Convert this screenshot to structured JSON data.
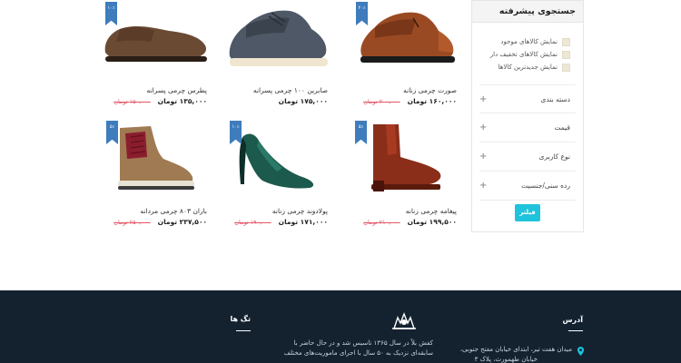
{
  "sidebar": {
    "title": "جستجوی پیشرفته",
    "checkboxes": [
      {
        "label": "نمایش کالاهای موجود"
      },
      {
        "label": "نمایش کالاهای تخفیف دار"
      },
      {
        "label": "نمایش جدیدترین کالاها"
      }
    ],
    "accordions": [
      {
        "label": "دسته بندی",
        "icon": "+"
      },
      {
        "label": "قیمت",
        "icon": "+"
      },
      {
        "label": "نوع کاربری",
        "icon": "+"
      },
      {
        "label": "رده سنی/جنسیت",
        "icon": "+"
      }
    ],
    "filter_button": "فیلتر"
  },
  "products": [
    {
      "name": "صورت چرمی زنانه",
      "price": "۱۶۰,۰۰۰ تومان",
      "old_price": "۲۰۰,۰۰۰ تومان",
      "ribbon": "۲۰٪"
    },
    {
      "name": "صابرین ۱۰۰ چرمی پسرانه",
      "price": "۱۷۵,۰۰۰ تومان",
      "old_price": "",
      "ribbon": ""
    },
    {
      "name": "پطرس چرمی پسرانه",
      "price": "۱۳۵,۰۰۰ تومان",
      "old_price": "۱۵۰,۰۰۰ تومان",
      "ribbon": "۱۰٪"
    },
    {
      "name": "پیغامه چرمی زنانه",
      "price": "۱۹۹,۵۰۰ تومان",
      "old_price": "۲۱۰,۰۰۰ تومان",
      "ribbon": "۵٪"
    },
    {
      "name": "پولادوند چرمی زنانه",
      "price": "۱۷۱,۰۰۰ تومان",
      "old_price": "۱۹۰,۰۰۰ تومان",
      "ribbon": "۱۰٪"
    },
    {
      "name": "باران ۸۰۳ چرمی مردانه",
      "price": "۲۳۷,۵۰۰ تومان",
      "old_price": "۲۵۰,۰۰۰ تومان",
      "ribbon": "۵٪"
    }
  ],
  "footer": {
    "address_title": "آدرس",
    "address_line1": "میدان هفت تیر، ابتدای خیابان مفتح جنوبی،",
    "address_line2": "خیابان طهمورث، پلاک ۳",
    "about_line1": "کفش بلاً در سال ۱۳۶۵ تاسیس شد و در حال حاضر با",
    "about_line2": "سابقه‌ای نزدیک به ۵۰ سال با اجرای ماموریت‌های مختلف",
    "tags_title": "تگ ها"
  },
  "colors": {
    "accent": "#1fc3dc",
    "ribbon": "#3e7cbc",
    "footer_bg": "#142230",
    "old_price": "#e35a6a"
  }
}
